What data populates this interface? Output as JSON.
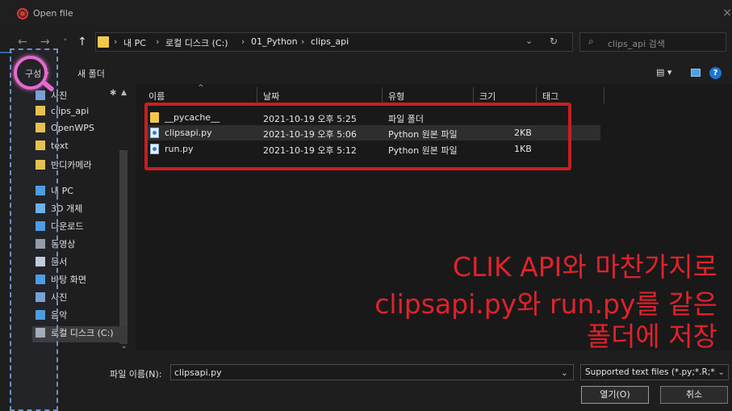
{
  "window": {
    "title": "Open file",
    "close": "×"
  },
  "nav_buttons": {
    "back": "←",
    "forward": "→",
    "recent": "˅",
    "up": "↑"
  },
  "address": {
    "crumbs": [
      "내 PC",
      "로컬 디스크 (C:)",
      "01_Python",
      "clips_api"
    ],
    "separator": "›",
    "dropdown": "⌄",
    "refresh": "↻"
  },
  "search": {
    "icon": "⌕",
    "placeholder": "clips_api 검색"
  },
  "commandbar": {
    "organize": "구성 ▾",
    "new_folder": "새 폴더",
    "view": "▤ ▾",
    "help": "?"
  },
  "sidebar": {
    "pin": "✱",
    "items": [
      {
        "label": "사진",
        "icon": "picture-icon",
        "color": "#7aa7d8"
      },
      {
        "label": "clips_api",
        "icon": "folder-icon",
        "color": "#f2c84b"
      },
      {
        "label": "OpenWPS",
        "icon": "folder-icon",
        "color": "#f2c84b"
      },
      {
        "label": "text",
        "icon": "folder-icon",
        "color": "#f2c84b"
      },
      {
        "label": "반디카메라",
        "icon": "folder-icon",
        "color": "#f2c84b"
      },
      {
        "label": "내 PC",
        "icon": "computer-icon",
        "color": "#4ea0e8"
      },
      {
        "label": "3D 개체",
        "icon": "cube-icon",
        "color": "#6fb6f0"
      },
      {
        "label": "다운로드",
        "icon": "download-icon",
        "color": "#4ea0e8"
      },
      {
        "label": "동영상",
        "icon": "video-icon",
        "color": "#9aa0a8"
      },
      {
        "label": "문서",
        "icon": "document-icon",
        "color": "#c9d4e0"
      },
      {
        "label": "바탕 화면",
        "icon": "desktop-icon",
        "color": "#4ea0e8"
      },
      {
        "label": "사진",
        "icon": "picture-icon",
        "color": "#7aa7d8"
      },
      {
        "label": "음악",
        "icon": "music-icon",
        "color": "#4ea0e8"
      },
      {
        "label": "로컬 디스크 (C:)",
        "icon": "drive-icon",
        "color": "#aab2bc"
      }
    ]
  },
  "columns": {
    "name": "이름",
    "date": "날짜",
    "type": "유형",
    "size": "크기",
    "tags": "태그"
  },
  "files": [
    {
      "name": "__pycache__",
      "date": "2021-10-19 오후 5:25",
      "type": "파일 폴더",
      "size": "",
      "kind": "folder"
    },
    {
      "name": "clipsapi.py",
      "date": "2021-10-19 오후 5:06",
      "type": "Python 원본 파일",
      "size": "2KB",
      "kind": "py"
    },
    {
      "name": "run.py",
      "date": "2021-10-19 오후 5:12",
      "type": "Python 원본 파일",
      "size": "1KB",
      "kind": "py"
    }
  ],
  "annotation": {
    "lines": [
      "CLIK API와 마찬가지로",
      "clipsapi.py와 run.py를 같은",
      "폴더에 저장"
    ],
    "color": "#e0222c"
  },
  "footer": {
    "filename_label": "파일 이름(N):",
    "filename_value": "clipsapi.py",
    "filetype_value": "Supported text files (*.py;*.R;*.",
    "dropdown": "⌄",
    "open_label": "열기(O)",
    "cancel_label": "취소"
  }
}
